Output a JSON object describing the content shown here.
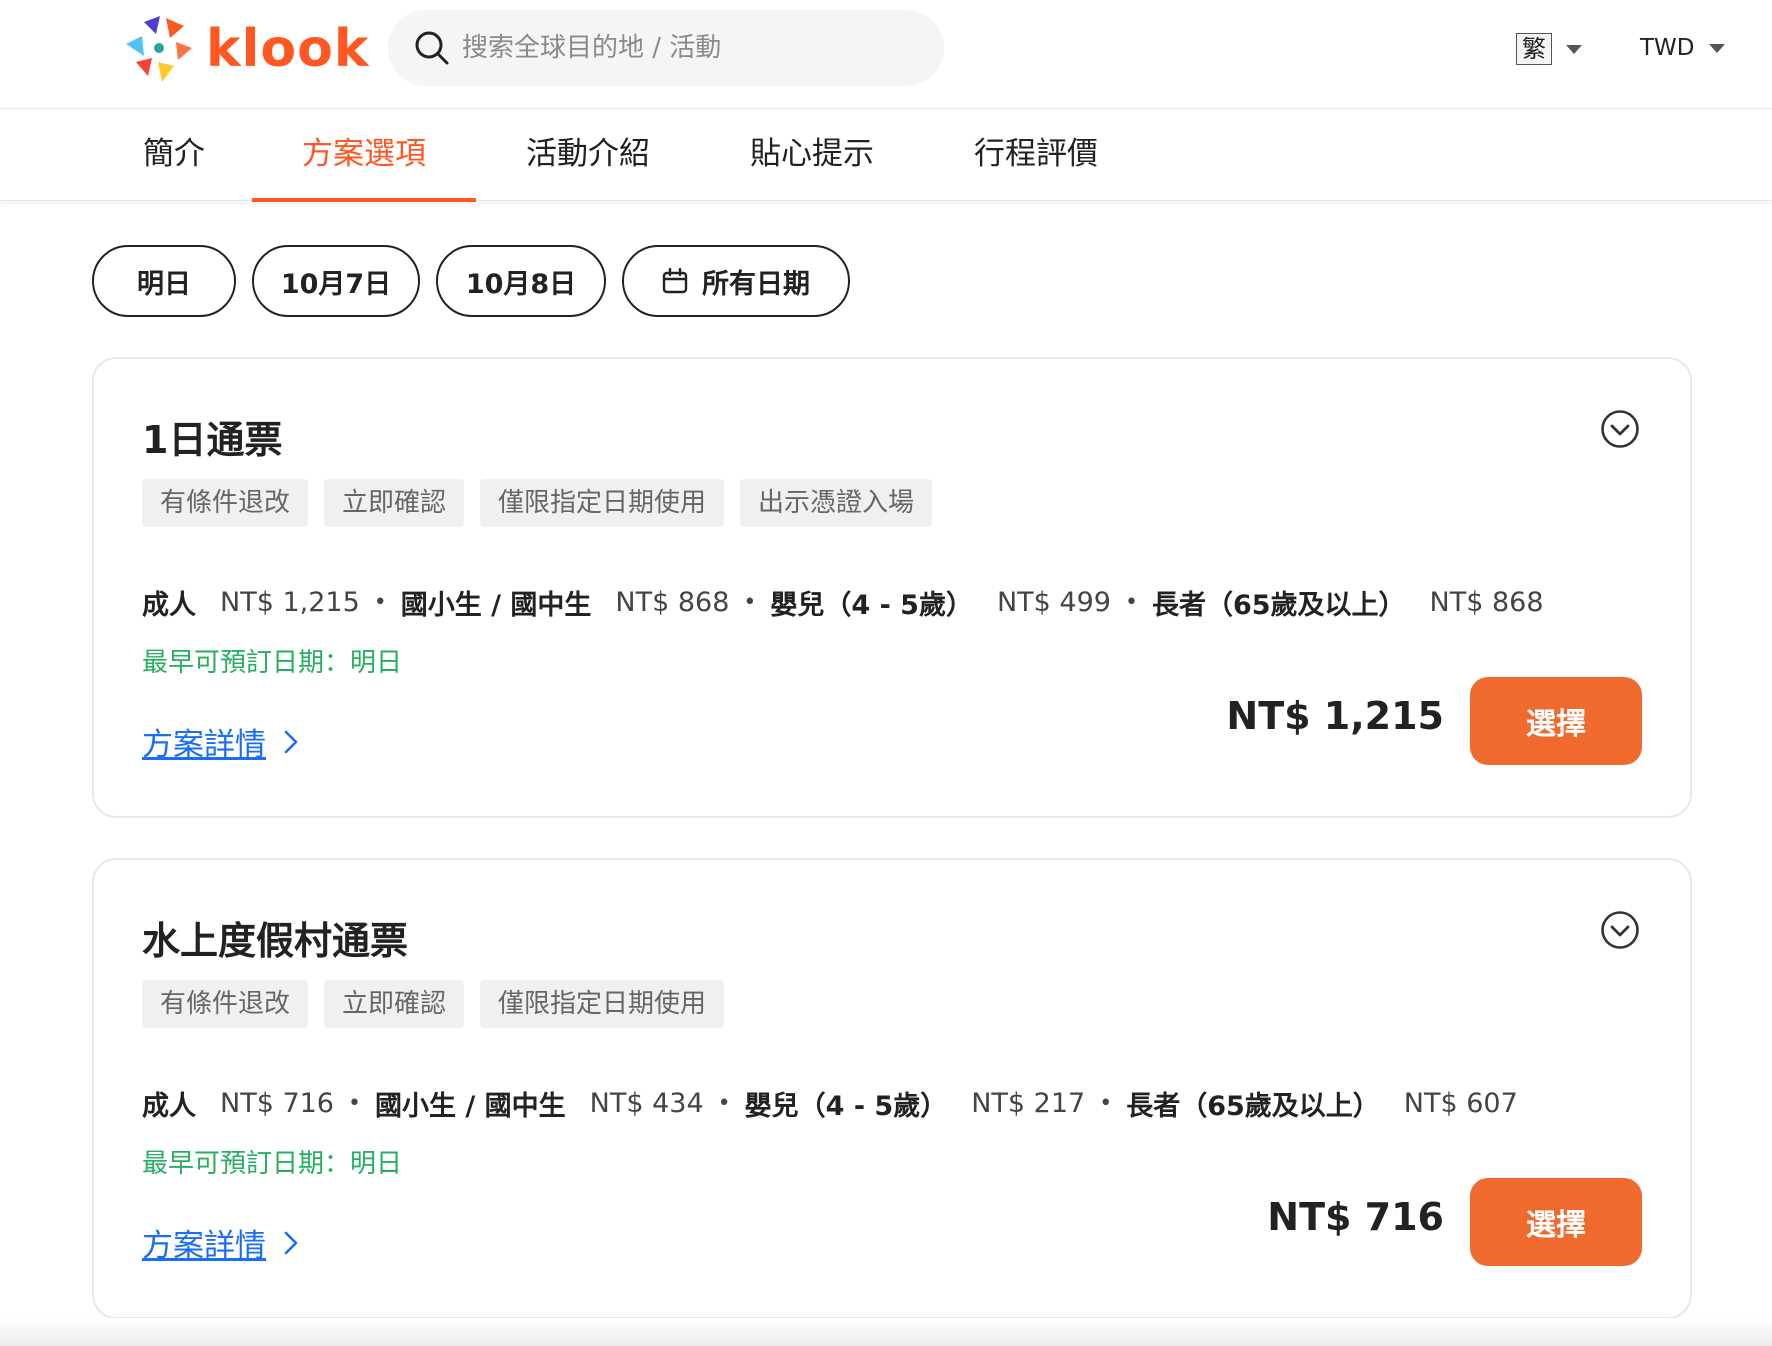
{
  "header": {
    "logo_text": "klook",
    "search_placeholder": "搜索全球目的地 / 活動",
    "language": "繁",
    "currency": "TWD"
  },
  "tabs": [
    {
      "label": "簡介",
      "active": false
    },
    {
      "label": "方案選項",
      "active": true
    },
    {
      "label": "活動介紹",
      "active": false
    },
    {
      "label": "貼心提示",
      "active": false
    },
    {
      "label": "行程評價",
      "active": false
    }
  ],
  "date_filters": [
    "明日",
    "10月7日",
    "10月8日",
    "所有日期"
  ],
  "packages": [
    {
      "title": "1日通票",
      "tags": [
        "有條件退改",
        "立即確認",
        "僅限指定日期使用",
        "出示憑證入場"
      ],
      "prices": [
        {
          "type": "成人",
          "price": "NT$ 1,215"
        },
        {
          "type": "國小生 / 國中生",
          "price": "NT$ 868"
        },
        {
          "type": "嬰兒（4 - 5歲）",
          "price": "NT$ 499"
        },
        {
          "type": "長者（65歲及以上）",
          "price": "NT$ 868"
        }
      ],
      "earliest_date": "最早可預訂日期：明日",
      "details_link": "方案詳情",
      "total_price": "NT$ 1,215",
      "select_label": "選擇"
    },
    {
      "title": "水上度假村通票",
      "tags": [
        "有條件退改",
        "立即確認",
        "僅限指定日期使用"
      ],
      "prices": [
        {
          "type": "成人",
          "price": "NT$ 716"
        },
        {
          "type": "國小生 / 國中生",
          "price": "NT$ 434"
        },
        {
          "type": "嬰兒（4 - 5歲）",
          "price": "NT$ 217"
        },
        {
          "type": "長者（65歲及以上）",
          "price": "NT$ 607"
        }
      ],
      "earliest_date": "最早可預訂日期：明日",
      "details_link": "方案詳情",
      "total_price": "NT$ 716",
      "select_label": "選擇"
    }
  ],
  "colors": {
    "brand": "#ff5722",
    "select_button": "#f06a2e",
    "link": "#1a6ef5",
    "earliest_date": "#27ae60",
    "tag_bg": "#f0f0f0"
  }
}
